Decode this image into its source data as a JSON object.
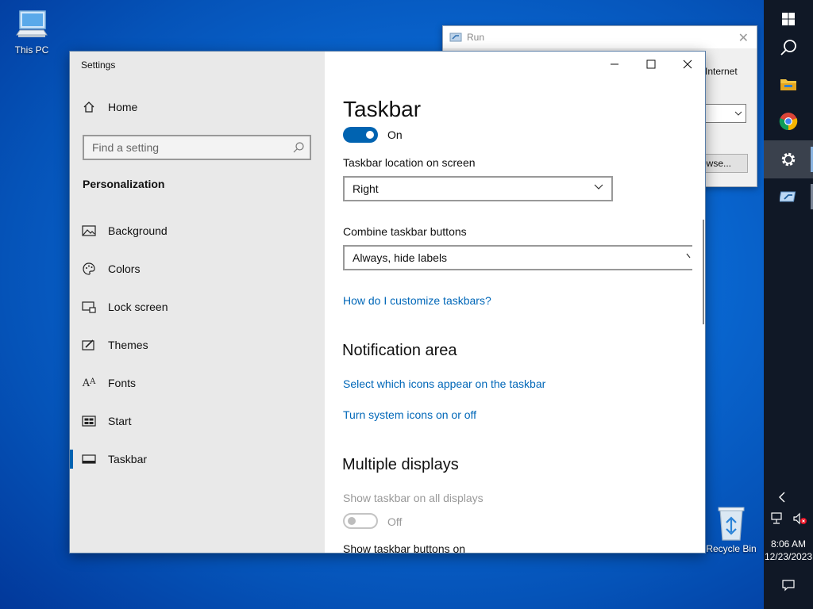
{
  "desktop": {
    "this_pc_label": "This PC",
    "recycle_bin_label": "Recycle Bin"
  },
  "run_dialog": {
    "title": "Run",
    "partial_text": "Internet",
    "browse_partial": "owse..."
  },
  "settings": {
    "window_title": "Settings",
    "home_label": "Home",
    "search_placeholder": "Find a setting",
    "section_heading": "Personalization",
    "nav": [
      {
        "label": "Background",
        "icon": "image-icon"
      },
      {
        "label": "Colors",
        "icon": "palette-icon"
      },
      {
        "label": "Lock screen",
        "icon": "lock-screen-icon"
      },
      {
        "label": "Themes",
        "icon": "themes-icon"
      },
      {
        "label": "Fonts",
        "icon": "fonts-icon"
      },
      {
        "label": "Start",
        "icon": "start-icon"
      },
      {
        "label": "Taskbar",
        "icon": "taskbar-icon",
        "selected": true
      }
    ],
    "page_title": "Taskbar",
    "toggle_top_state": "On",
    "taskbar_location_label": "Taskbar location on screen",
    "taskbar_location_value": "Right",
    "combine_label": "Combine taskbar buttons",
    "combine_value": "Always, hide labels",
    "customize_link": "How do I customize taskbars?",
    "notification_heading": "Notification area",
    "select_icons_link": "Select which icons appear on the taskbar",
    "system_icons_link": "Turn system icons on or off",
    "multiple_displays_heading": "Multiple displays",
    "show_all_displays_label": "Show taskbar on all displays",
    "show_all_displays_state": "Off",
    "show_buttons_on_label": "Show taskbar buttons on"
  },
  "taskbar": {
    "time": "8:06 AM",
    "date": "12/23/2023",
    "pinned": [
      "start-icon",
      "search-icon",
      "file-explorer-icon",
      "chrome-icon",
      "settings-icon",
      "run-icon"
    ]
  },
  "colors": {
    "accent": "#0063b1",
    "link": "#0067b8"
  }
}
